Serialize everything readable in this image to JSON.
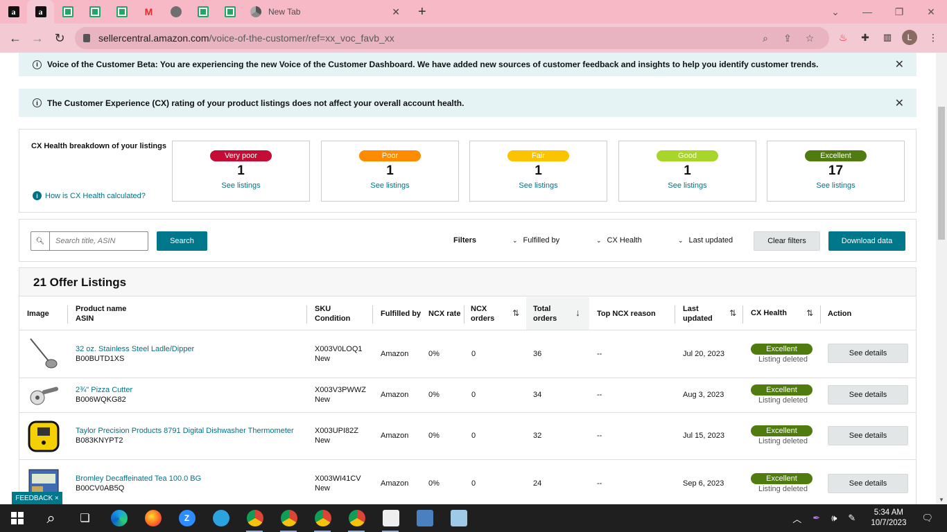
{
  "browser": {
    "tabs": {
      "new_tab_title": "New Tab"
    },
    "url_host": "sellercentral.amazon.com",
    "url_path": "/voice-of-the-customer/ref=xx_voc_favb_xx",
    "profile_initial": "L"
  },
  "alerts": {
    "beta": "Voice of the Customer Beta: You are experiencing the new Voice of the Customer Dashboard. We have added new sources of customer feedback and insights to help you identify customer trends.",
    "cx": "The Customer Experience (CX) rating of your product listings does not affect your overall account health."
  },
  "health": {
    "title": "CX Health breakdown of your listings",
    "how_link": "How is CX Health calculated?",
    "cards": [
      {
        "label": "Very poor",
        "count": "1",
        "link": "See listings",
        "color": "#c40c35"
      },
      {
        "label": "Poor",
        "count": "1",
        "link": "See listings",
        "color": "#ff8b00"
      },
      {
        "label": "Fair",
        "count": "1",
        "link": "See listings",
        "color": "#fbc300"
      },
      {
        "label": "Good",
        "count": "1",
        "link": "See listings",
        "color": "#a8d529"
      },
      {
        "label": "Excellent",
        "count": "17",
        "link": "See listings",
        "color": "#507b0f"
      }
    ]
  },
  "filters": {
    "search_placeholder": "Search title, ASIN",
    "search_button": "Search",
    "filters_label": "Filters",
    "fulfilled_by": "Fulfilled by",
    "cx_health": "CX Health",
    "last_updated": "Last updated",
    "clear": "Clear filters",
    "download": "Download data"
  },
  "table": {
    "title": "21 Offer Listings",
    "headers": {
      "image": "Image",
      "product_name": "Product name",
      "asin": "ASIN",
      "sku": "SKU",
      "condition": "Condition",
      "fulfilled_by": "Fulfilled by",
      "ncx_rate": "NCX rate",
      "ncx_orders_1": "NCX",
      "ncx_orders_2": "orders",
      "total_orders_1": "Total",
      "total_orders_2": "orders",
      "top_reason": "Top NCX reason",
      "last_updated_1": "Last",
      "last_updated_2": "updated",
      "cx_health": "CX Health",
      "action": "Action"
    },
    "rows": [
      {
        "name": "32 oz. Stainless Steel Ladle/Dipper",
        "asin": "B00BUTD1XS",
        "sku": "X003V0LOQ1",
        "condition": "New",
        "fulfilled": "Amazon",
        "ncx_rate": "0%",
        "ncx_orders": "0",
        "total_orders": "36",
        "reason": "--",
        "updated": "Jul 20, 2023",
        "health": "Excellent",
        "status": "Listing deleted",
        "action": "See details"
      },
      {
        "name": "2¾\" Pizza Cutter",
        "asin": "B006WQKG82",
        "sku": "X003V3PWWZ",
        "condition": "New",
        "fulfilled": "Amazon",
        "ncx_rate": "0%",
        "ncx_orders": "0",
        "total_orders": "34",
        "reason": "--",
        "updated": "Aug 3, 2023",
        "health": "Excellent",
        "status": "Listing deleted",
        "action": "See details"
      },
      {
        "name": "Taylor Precision Products 8791 Digital Dishwasher Thermometer",
        "asin": "B083KNYPT2",
        "sku": "X003UPI82Z",
        "condition": "New",
        "fulfilled": "Amazon",
        "ncx_rate": "0%",
        "ncx_orders": "0",
        "total_orders": "32",
        "reason": "--",
        "updated": "Jul 15, 2023",
        "health": "Excellent",
        "status": "Listing deleted",
        "action": "See details"
      },
      {
        "name": "Bromley Decaffeinated Tea 100.0 BG",
        "asin": "B00CV0AB5Q",
        "sku": "X003WI41CV",
        "condition": "New",
        "fulfilled": "Amazon",
        "ncx_rate": "0%",
        "ncx_orders": "0",
        "total_orders": "24",
        "reason": "--",
        "updated": "Sep 6, 2023",
        "health": "Excellent",
        "status": "Listing deleted",
        "action": "See details"
      }
    ]
  },
  "feedback": "FEEDBACK ×",
  "taskbar": {
    "time": "5:34 AM",
    "date": "10/7/2023"
  }
}
